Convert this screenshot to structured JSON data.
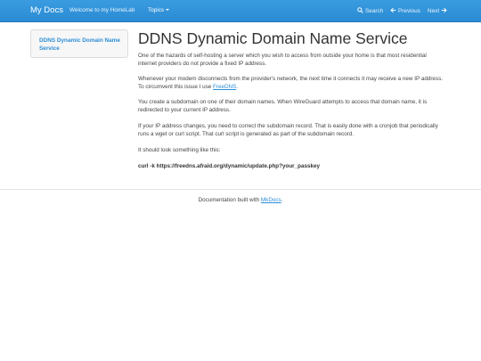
{
  "navbar": {
    "brand": "My Docs",
    "home_link": "Welcome to my HomeLab",
    "topics_menu": "Topics",
    "search": "Search",
    "previous": "Previous",
    "next": "Next"
  },
  "sidebar": {
    "items": [
      {
        "label": "DDNS Dynamic Domain Name Service"
      }
    ]
  },
  "content": {
    "title": "DDNS Dynamic Domain Name Service",
    "p1": "One of the hazards of self-hosting a server which you wish to access from outside your home is that most residential internet providers do not provide a fixed IP address.",
    "p2_before": "Whenever your modem disconnects from the provider's network, the next time it connects it may receive a new IP address. To circumvent this issue I use ",
    "p2_link": "FreeDNS",
    "p2_after": ".",
    "p3": "You create a subdomain on one of their domain names. When WireGuard attempts to access that domain name, it is redirected to your current IP address.",
    "p4": "If your IP address changes, you need to correct the subdomain record. That is easily done with a cronjob that periodically runs a wget or curl script. That curl script is generated as part of the subdomain record.",
    "p5": "It should look something like this:",
    "code": "curl -k https://freedns.afraid.org/dynamic/update.php?your_passkey"
  },
  "footer": {
    "text_before": "Documentation built with ",
    "link": "MkDocs",
    "text_after": "."
  },
  "colors": {
    "navbar": "#2c8ed6",
    "link": "#2c8ed6"
  },
  "icons": [
    "search-icon",
    "arrow-left-icon",
    "arrow-right-icon",
    "caret-down-icon"
  ]
}
